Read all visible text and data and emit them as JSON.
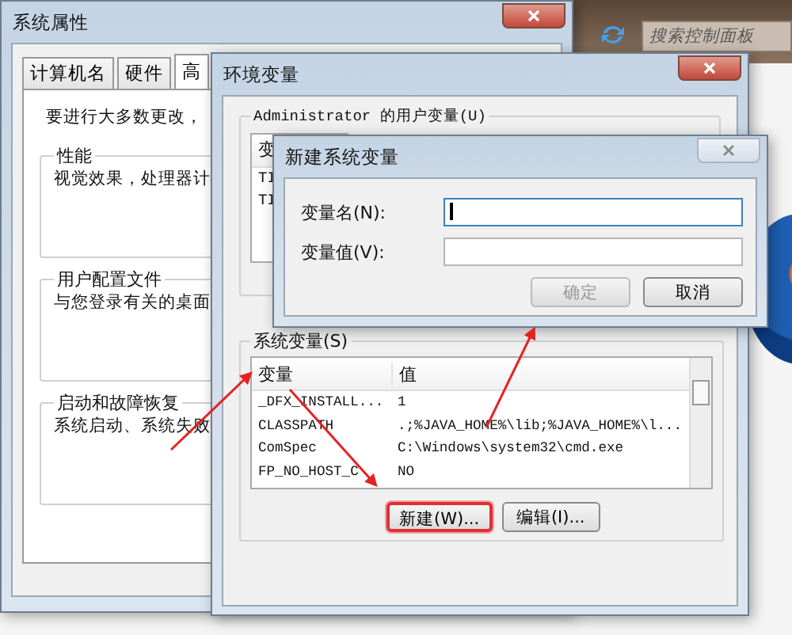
{
  "control_panel": {
    "search": {
      "placeholder": "搜索控制面板"
    }
  },
  "system_properties": {
    "title": "系统属性",
    "tabs": [
      {
        "label": "计算机名",
        "selected": false
      },
      {
        "label": "硬件",
        "selected": false
      },
      {
        "label": "高",
        "selected": true
      }
    ],
    "intro": "要进行大多数更改，",
    "groups": [
      {
        "title": "性能",
        "text": "视觉效果，处理器计"
      },
      {
        "title": "用户配置文件",
        "text": "与您登录有关的桌面"
      },
      {
        "title": "启动和故障恢复",
        "text": "系统启动、系统失败"
      }
    ]
  },
  "environment_variables": {
    "title": "环境变量",
    "user_variables": {
      "title": "Administrator 的用户变量(U)",
      "header": "变",
      "rows": [
        "TI",
        "TI"
      ]
    },
    "system_variables": {
      "title": "系统变量(S)",
      "columns": [
        "变量",
        "值"
      ],
      "rows": [
        {
          "name": "_DFX_INSTALL...",
          "value": "1"
        },
        {
          "name": "CLASSPATH",
          "value": ".;%JAVA_HOME%\\lib;%JAVA_HOME%\\l..."
        },
        {
          "name": "ComSpec",
          "value": "C:\\Windows\\system32\\cmd.exe"
        },
        {
          "name": "FP_NO_HOST_C",
          "value": "NO"
        }
      ],
      "buttons": [
        {
          "label": "新建(W)...",
          "highlighted": true
        },
        {
          "label": "编辑(I)...",
          "highlighted": false
        }
      ]
    }
  },
  "new_variable_dialog": {
    "title": "新建系统变量",
    "fields": [
      {
        "label": "变量名(N):",
        "focused": true
      },
      {
        "label": "变量值(V):",
        "focused": false
      }
    ],
    "buttons": [
      {
        "label": "确定",
        "disabled": true
      },
      {
        "label": "取消",
        "disabled": false
      }
    ]
  }
}
